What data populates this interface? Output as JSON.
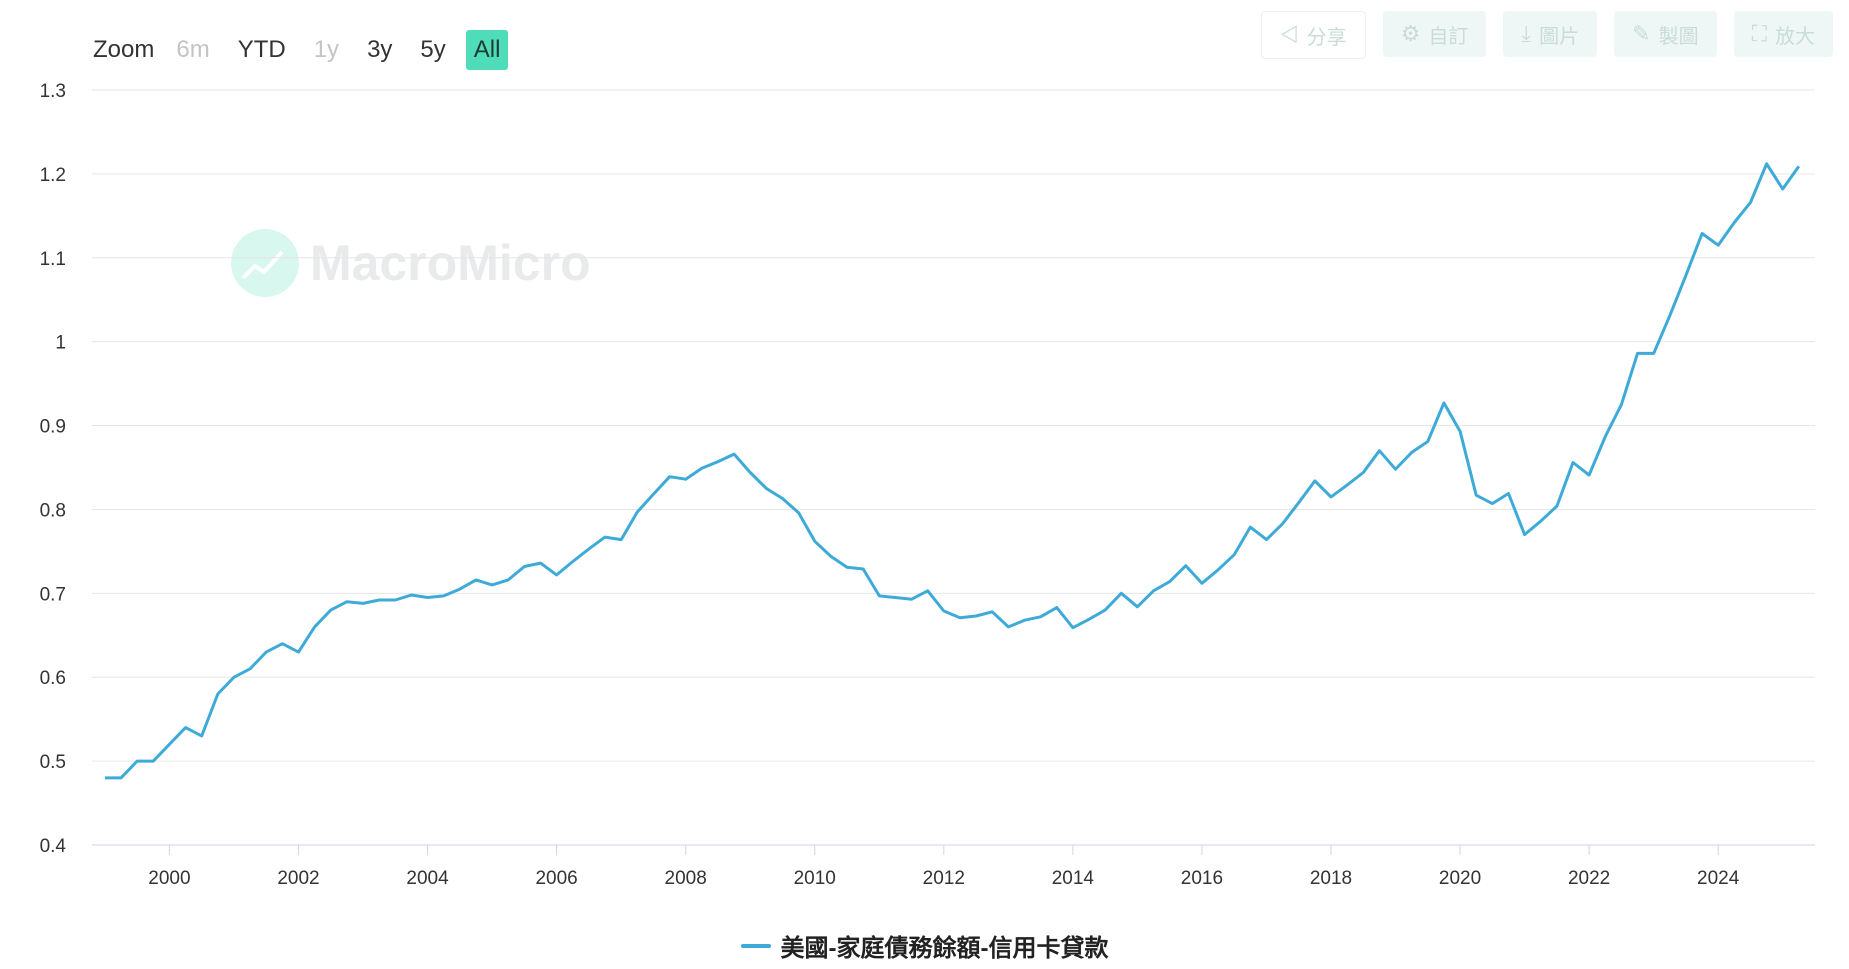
{
  "zoom": {
    "label": "Zoom",
    "buttons": [
      {
        "label": "6m",
        "state": "disabled"
      },
      {
        "label": "YTD",
        "state": "normal"
      },
      {
        "label": "1y",
        "state": "disabled"
      },
      {
        "label": "3y",
        "state": "normal"
      },
      {
        "label": "5y",
        "state": "normal"
      },
      {
        "label": "All",
        "state": "active"
      }
    ]
  },
  "toolbar": {
    "share": "分享",
    "custom": "自訂",
    "image": "圖片",
    "draw": "製圖",
    "expand": "放大"
  },
  "watermark": "MacroMicro",
  "colors": {
    "line": "#3daad8",
    "active_button": "#4fdcb8",
    "grid": "#e6e6e6"
  },
  "chart_data": {
    "type": "line",
    "title": "",
    "xlabel": "",
    "ylabel": "",
    "ylim": [
      0.4,
      1.3
    ],
    "y_ticks": [
      "0.4",
      "0.5",
      "0.6",
      "0.7",
      "0.8",
      "0.9",
      "1",
      "1.1",
      "1.2",
      "1.3"
    ],
    "x_ticks": [
      "2000",
      "2002",
      "2004",
      "2006",
      "2008",
      "2010",
      "2012",
      "2014",
      "2016",
      "2018",
      "2020",
      "2022",
      "2024"
    ],
    "xlim": [
      1998.8,
      2025.5
    ],
    "grid": true,
    "legend": "bottom-center",
    "series": [
      {
        "name": "美國-家庭債務餘額-信用卡貸款",
        "color": "#3daad8",
        "x": [
          1999.0,
          1999.25,
          1999.5,
          1999.75,
          2000.0,
          2000.25,
          2000.5,
          2000.75,
          2001.0,
          2001.25,
          2001.5,
          2001.75,
          2002.0,
          2002.25,
          2002.5,
          2002.75,
          2003.0,
          2003.25,
          2003.5,
          2003.75,
          2004.0,
          2004.25,
          2004.5,
          2004.75,
          2005.0,
          2005.25,
          2005.5,
          2005.75,
          2006.0,
          2006.25,
          2006.5,
          2006.75,
          2007.0,
          2007.25,
          2007.5,
          2007.75,
          2008.0,
          2008.25,
          2008.5,
          2008.75,
          2009.0,
          2009.25,
          2009.5,
          2009.75,
          2010.0,
          2010.25,
          2010.5,
          2010.75,
          2011.0,
          2011.25,
          2011.5,
          2011.75,
          2012.0,
          2012.25,
          2012.5,
          2012.75,
          2013.0,
          2013.25,
          2013.5,
          2013.75,
          2014.0,
          2014.25,
          2014.5,
          2014.75,
          2015.0,
          2015.25,
          2015.5,
          2015.75,
          2016.0,
          2016.25,
          2016.5,
          2016.75,
          2017.0,
          2017.25,
          2017.5,
          2017.75,
          2018.0,
          2018.25,
          2018.5,
          2018.75,
          2019.0,
          2019.25,
          2019.5,
          2019.75,
          2020.0,
          2020.25,
          2020.5,
          2020.75,
          2021.0,
          2021.25,
          2021.5,
          2021.75,
          2022.0,
          2022.25,
          2022.5,
          2022.75,
          2023.0,
          2023.25,
          2023.5,
          2023.75,
          2024.0,
          2024.25,
          2024.5,
          2024.75,
          2025.0,
          2025.25
        ],
        "values": [
          0.48,
          0.48,
          0.5,
          0.5,
          0.52,
          0.54,
          0.53,
          0.58,
          0.6,
          0.61,
          0.63,
          0.64,
          0.63,
          0.66,
          0.68,
          0.69,
          0.688,
          0.692,
          0.692,
          0.698,
          0.695,
          0.697,
          0.705,
          0.716,
          0.71,
          0.716,
          0.732,
          0.736,
          0.722,
          0.738,
          0.753,
          0.767,
          0.764,
          0.797,
          0.818,
          0.839,
          0.836,
          0.849,
          0.857,
          0.866,
          0.844,
          0.825,
          0.813,
          0.796,
          0.762,
          0.744,
          0.731,
          0.729,
          0.697,
          0.695,
          0.693,
          0.703,
          0.679,
          0.671,
          0.673,
          0.678,
          0.66,
          0.668,
          0.672,
          0.683,
          0.659,
          0.669,
          0.68,
          0.7,
          0.684,
          0.703,
          0.714,
          0.733,
          0.712,
          0.728,
          0.746,
          0.779,
          0.764,
          0.783,
          0.808,
          0.834,
          0.815,
          0.829,
          0.844,
          0.87,
          0.848,
          0.868,
          0.881,
          0.927,
          0.893,
          0.817,
          0.807,
          0.819,
          0.77,
          0.786,
          0.804,
          0.856,
          0.841,
          0.887,
          0.925,
          0.986,
          0.986,
          1.031,
          1.079,
          1.129,
          1.115,
          1.142,
          1.166,
          1.212,
          1.182,
          1.209
        ]
      }
    ]
  }
}
